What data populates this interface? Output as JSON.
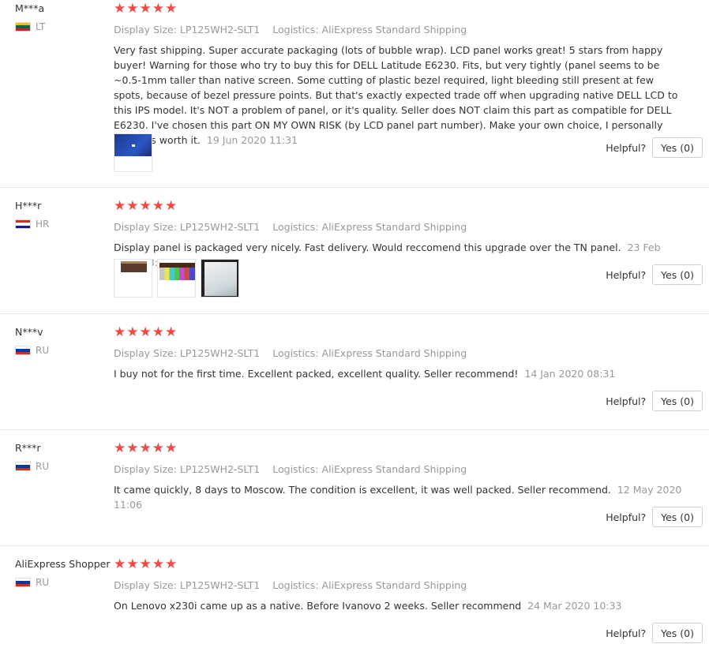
{
  "reviews": [
    {
      "user": "M***a",
      "country": "LT",
      "flag_colors": [
        "#fdb913",
        "#006a44",
        "#c1272d"
      ],
      "stars": "★★★★★",
      "display_size_label": "Display Size:",
      "display_size": "LP125WH2-SLT1",
      "logistics_label": "Logistics:",
      "logistics": "AliExpress Standard Shipping",
      "text": "Very fast shipping. Super accurate packaging (lots of bubble wrap). LCD panel works great! 5 stars from happy buyer! Warning for those who try to buy this for DELL Latitude E6230. Fits, but very tightly (panel seems to be ~0.5-1mm taller than native screen. Some cutting of plastic bezel required, light bleeding still present at few spots, because of bezel pressure points. But that's exactly expected trade off when upgrading native DELL LCD to this IPS model. It's NOT a problem of panel, or it's quality. Seller does NOT claim this part as compatible for DELL E6230. I've chosen this part ON MY OWN RISK (by LCD panel part number). Make your own choice, I personally think it's worth it.",
      "date": "19 Jun 2020 11:31",
      "helpful_label": "Helpful?",
      "yes_label": "Yes (0)"
    },
    {
      "user": "H***r",
      "country": "HR",
      "flag_colors": [
        "#d52b1e",
        "#ffffff",
        "#171796"
      ],
      "stars": "★★★★★",
      "display_size_label": "Display Size:",
      "display_size": "LP125WH2-SLT1",
      "logistics_label": "Logistics:",
      "logistics": "AliExpress Standard Shipping",
      "text": "Display panel is packaged very nicely. Fast delivery. Would reccomend this upgrade over the TN panel.",
      "date": "23 Feb 2020 08:28",
      "helpful_label": "Helpful?",
      "yes_label": "Yes (0)"
    },
    {
      "user": "N***v",
      "country": "RU",
      "flag_colors": [
        "#ffffff",
        "#0039a6",
        "#d52b1e"
      ],
      "stars": "★★★★★",
      "display_size_label": "Display Size:",
      "display_size": "LP125WH2-SLT1",
      "logistics_label": "Logistics:",
      "logistics": "AliExpress Standard Shipping",
      "text": "I buy not for the first time. Excellent packed, excellent quality. Seller recommend!",
      "date": "14 Jan 2020 08:31",
      "helpful_label": "Helpful?",
      "yes_label": "Yes (0)"
    },
    {
      "user": "R***r",
      "country": "RU",
      "flag_colors": [
        "#ffffff",
        "#0039a6",
        "#d52b1e"
      ],
      "stars": "★★★★★",
      "display_size_label": "Display Size:",
      "display_size": "LP125WH2-SLT1",
      "logistics_label": "Logistics:",
      "logistics": "AliExpress Standard Shipping",
      "text": "It came quickly, 8 days to Moscow. The condition is excellent, it was well packed. Seller recommend.",
      "date": "12 May 2020 11:06",
      "helpful_label": "Helpful?",
      "yes_label": "Yes (0)"
    },
    {
      "user": "AliExpress Shopper",
      "country": "RU",
      "flag_colors": [
        "#ffffff",
        "#0039a6",
        "#d52b1e"
      ],
      "stars": "★★★★★",
      "display_size_label": "Display Size:",
      "display_size": "LP125WH2-SLT1",
      "logistics_label": "Logistics:",
      "logistics": "AliExpress Standard Shipping",
      "text": "On Lenovo x230i came up as a native. Before Ivanovo 2 weeks. Seller recommend",
      "date": "24 Mar 2020 10:33",
      "helpful_label": "Helpful?",
      "yes_label": "Yes (0)"
    }
  ]
}
